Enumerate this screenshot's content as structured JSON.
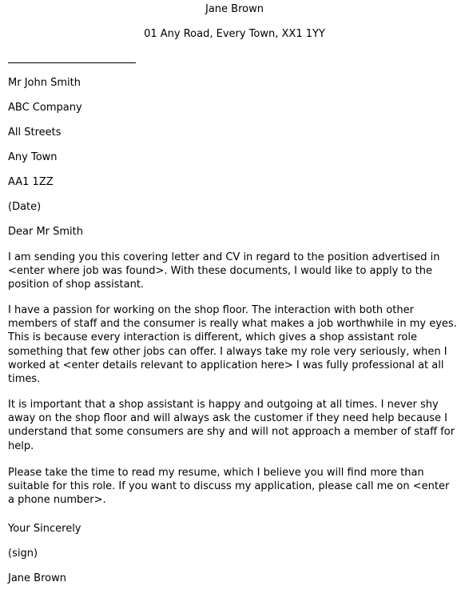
{
  "sender": {
    "name": "Jane Brown",
    "address": "01 Any Road, Every Town, XX1 1YY"
  },
  "recipient": {
    "lines": [
      "Mr John Smith",
      "ABC Company",
      "All Streets",
      "Any Town",
      "AA1 1ZZ"
    ]
  },
  "date": "(Date)",
  "salutation": "Dear Mr Smith",
  "paragraphs": [
    {
      "lines": [
        "I am sending you this covering letter and CV in regard to the position advertised in",
        "<enter where job was found>. With these documents, I would like to apply to the",
        "position of shop assistant."
      ]
    },
    {
      "lines": [
        "I have a passion for working on the shop floor. The interaction with both other",
        "members of staff and the consumer is really what makes a job worthwhile in my eyes.",
        "This is because every interaction is different, which gives a shop assistant role",
        "something that few other jobs can offer. I always take my role very seriously, when I",
        "worked at <enter details relevant to application here> I was fully professional at all",
        "times."
      ]
    },
    {
      "lines": [
        "It is important that a shop assistant is happy and outgoing at all times. I never shy",
        "away on the shop floor and will always ask the customer if they need help because I",
        "understand that some consumers are shy and will not approach a member of staff for",
        "help."
      ]
    },
    {
      "lines": [
        "Please take the time to read my resume, which I believe you will find more than",
        "suitable for this role. If you want to discuss my application, please call me on <enter",
        "a phone number>."
      ]
    }
  ],
  "closing": "Your Sincerely",
  "signature": "(sign)",
  "signoff_name": "Jane Brown"
}
